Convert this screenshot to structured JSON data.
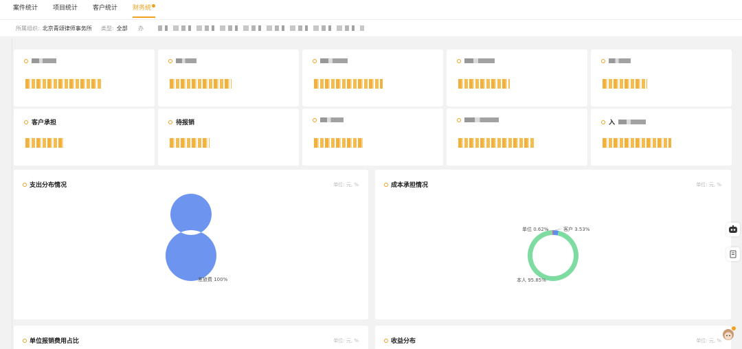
{
  "tabs": [
    {
      "label": "案件统计"
    },
    {
      "label": "项目统计"
    },
    {
      "label": "客户统计"
    },
    {
      "label": "财务统"
    }
  ],
  "filters": {
    "org_label": "所属组织:",
    "org_value": "北京青颂律师事务所",
    "type_label": "类型:",
    "type_value": "全部",
    "date_label": "办"
  },
  "stats": [
    {
      "title": "",
      "value": ""
    },
    {
      "title": "",
      "value": ""
    },
    {
      "title": "",
      "value": ""
    },
    {
      "title": "",
      "value": ""
    },
    {
      "title": "",
      "value": ""
    },
    {
      "title": "客户承担",
      "value": ""
    },
    {
      "title": "待报销",
      "value": ""
    },
    {
      "title": "",
      "value": ""
    },
    {
      "title": "",
      "value": ""
    },
    {
      "title": "入",
      "value": ""
    }
  ],
  "panels": {
    "expense": {
      "title": "支出分布情况",
      "unit": "单位: 元, %"
    },
    "cost": {
      "title": "成本承担情况",
      "unit": "单位: 元, %"
    },
    "reimburse": {
      "title": "单位报销费用占比",
      "unit": "单位: 元, %"
    },
    "income": {
      "title": "收益分布",
      "unit": "单位: 元, %"
    }
  },
  "colors": {
    "accent": "#f0a21c",
    "donut_blue": "#6d95ef",
    "donut_green": "#7edba1",
    "donut_lightblue": "#5b8ff0",
    "donut_red": "#ef6f6c"
  },
  "chart_data": [
    {
      "type": "pie",
      "title": "支出分布情况",
      "labels": [
        "差旅费 100%"
      ],
      "values": [
        100
      ]
    },
    {
      "type": "pie",
      "title": "成本承担情况",
      "labels": [
        "本人 95.85%",
        "客户 3.53%",
        "单位 0.62%"
      ],
      "values": [
        95.85,
        3.53,
        0.62
      ]
    }
  ]
}
